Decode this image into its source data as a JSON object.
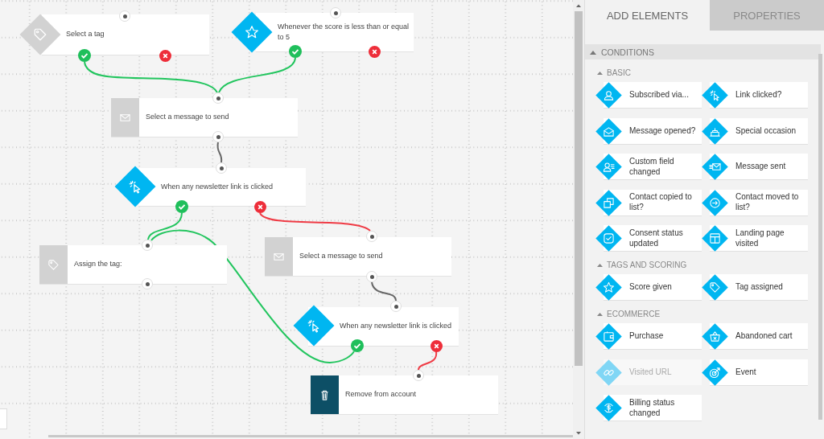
{
  "canvas": {
    "nodes": [
      {
        "kind": "condition",
        "configured": false,
        "text": "Select a tag"
      },
      {
        "kind": "condition",
        "configured": true,
        "text": "Whenever the score is less than or equal to 5"
      },
      {
        "kind": "action",
        "configured": false,
        "text": "Select a message to send"
      },
      {
        "kind": "condition",
        "configured": true,
        "text": "When any newsletter link is clicked"
      },
      {
        "kind": "action",
        "configured": false,
        "text": "Assign the tag:"
      },
      {
        "kind": "action",
        "configured": false,
        "text": "Select a message to send"
      },
      {
        "kind": "condition",
        "configured": true,
        "text": "When any newsletter link is clicked"
      },
      {
        "kind": "action",
        "configured": true,
        "text": "Remove from account"
      }
    ]
  },
  "tabs": [
    {
      "label": "ADD ELEMENTS",
      "selected": true
    },
    {
      "label": "PROPERTIES",
      "selected": false
    }
  ],
  "panel": {
    "sections": [
      {
        "title": "CONDITIONS",
        "expanded": true,
        "groups": [
          {
            "title": "BASIC",
            "expanded": true,
            "items": [
              {
                "label": "Subscribed via...",
                "disabled": false
              },
              {
                "label": "Link clicked?",
                "disabled": false
              },
              {
                "label": "Message opened?",
                "disabled": false
              },
              {
                "label": "Special occasion",
                "disabled": false
              },
              {
                "label": "Custom field changed",
                "disabled": false
              },
              {
                "label": "Message sent",
                "disabled": false
              },
              {
                "label": "Contact copied to list?",
                "disabled": false
              },
              {
                "label": "Contact moved to list?",
                "disabled": false
              },
              {
                "label": "Consent status updated",
                "disabled": false
              },
              {
                "label": "Landing page visited",
                "disabled": false
              }
            ]
          },
          {
            "title": "TAGS AND SCORING",
            "expanded": true,
            "items": [
              {
                "label": "Score given",
                "disabled": false
              },
              {
                "label": "Tag assigned",
                "disabled": false
              }
            ]
          },
          {
            "title": "ECOMMERCE",
            "expanded": true,
            "items": [
              {
                "label": "Purchase",
                "disabled": false
              },
              {
                "label": "Abandoned cart",
                "disabled": false
              },
              {
                "label": "Visited URL",
                "disabled": true
              },
              {
                "label": "Event",
                "disabled": false
              },
              {
                "label": "Billing status changed",
                "disabled": false
              }
            ]
          }
        ]
      }
    ]
  }
}
